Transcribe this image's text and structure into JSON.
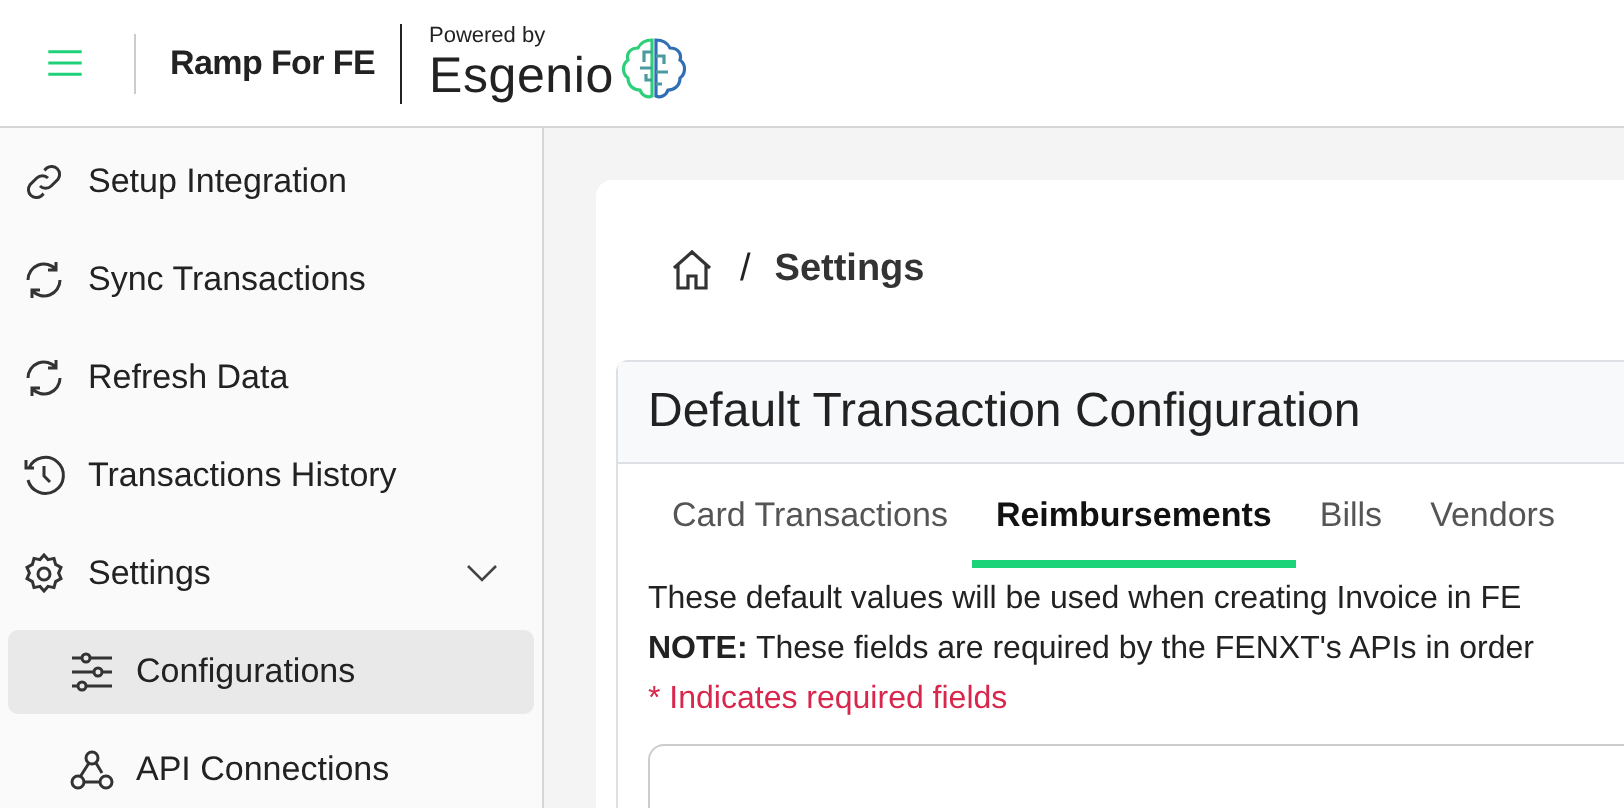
{
  "header": {
    "app_name": "Ramp For FE",
    "powered_by": "Powered by",
    "brand": "Esgenio"
  },
  "sidebar": {
    "items": [
      {
        "label": "Setup Integration",
        "kind": "link",
        "selected": false
      },
      {
        "label": "Sync Transactions",
        "kind": "sync",
        "selected": false
      },
      {
        "label": "Refresh Data",
        "kind": "sync",
        "selected": false
      },
      {
        "label": "Transactions History",
        "kind": "history",
        "selected": false
      },
      {
        "label": "Settings",
        "kind": "gear",
        "selected": false,
        "expanded": true,
        "children": [
          {
            "label": "Configurations",
            "kind": "sliders",
            "selected": true
          },
          {
            "label": "API Connections",
            "kind": "webhook",
            "selected": false
          }
        ]
      }
    ]
  },
  "breadcrumb": {
    "separator": "/",
    "current": "Settings"
  },
  "card": {
    "title": "Default Transaction Configuration",
    "tabs": [
      {
        "label": "Card Transactions",
        "selected": false
      },
      {
        "label": "Reimbursements",
        "selected": true
      },
      {
        "label": "Bills",
        "selected": false
      },
      {
        "label": "Vendors",
        "selected": false
      }
    ],
    "description": "These default values will be used when creating Invoice in FE",
    "note": "**NOTE:** These fields are required by the FENXT's APIs in order",
    "required_hint": "* Indicates required fields"
  }
}
